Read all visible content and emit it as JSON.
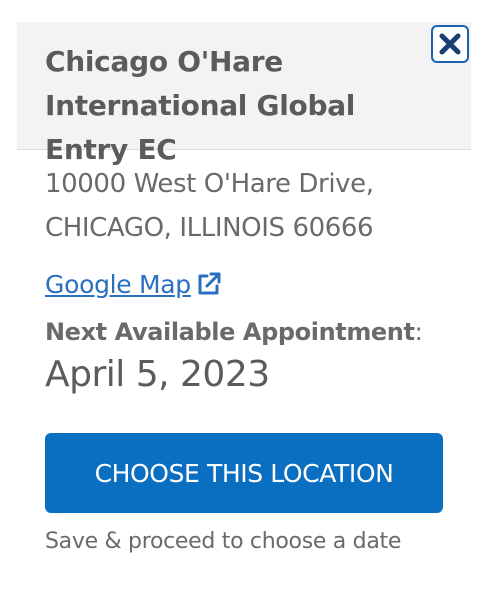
{
  "location": {
    "name": "Chicago O'Hare International Global Entry EC",
    "address_line1": "10000 West O'Hare Drive,",
    "address_line2": "CHICAGO, ILLINOIS 60666",
    "map_link_label": "Google Map",
    "next_appointment_label": "Next Available Appointment",
    "next_appointment_colon": ":",
    "next_appointment_date": "April 5, 2023"
  },
  "actions": {
    "choose_label": "CHOOSE THIS LOCATION",
    "helper_text": "Save & proceed to choose a date"
  },
  "icons": {
    "close": "close-icon",
    "external_link": "external-link-icon"
  },
  "colors": {
    "accent": "#0a6ec1",
    "link": "#2a6fc0",
    "header_bg": "#f3f3f3",
    "text": "#6a6a6a"
  }
}
